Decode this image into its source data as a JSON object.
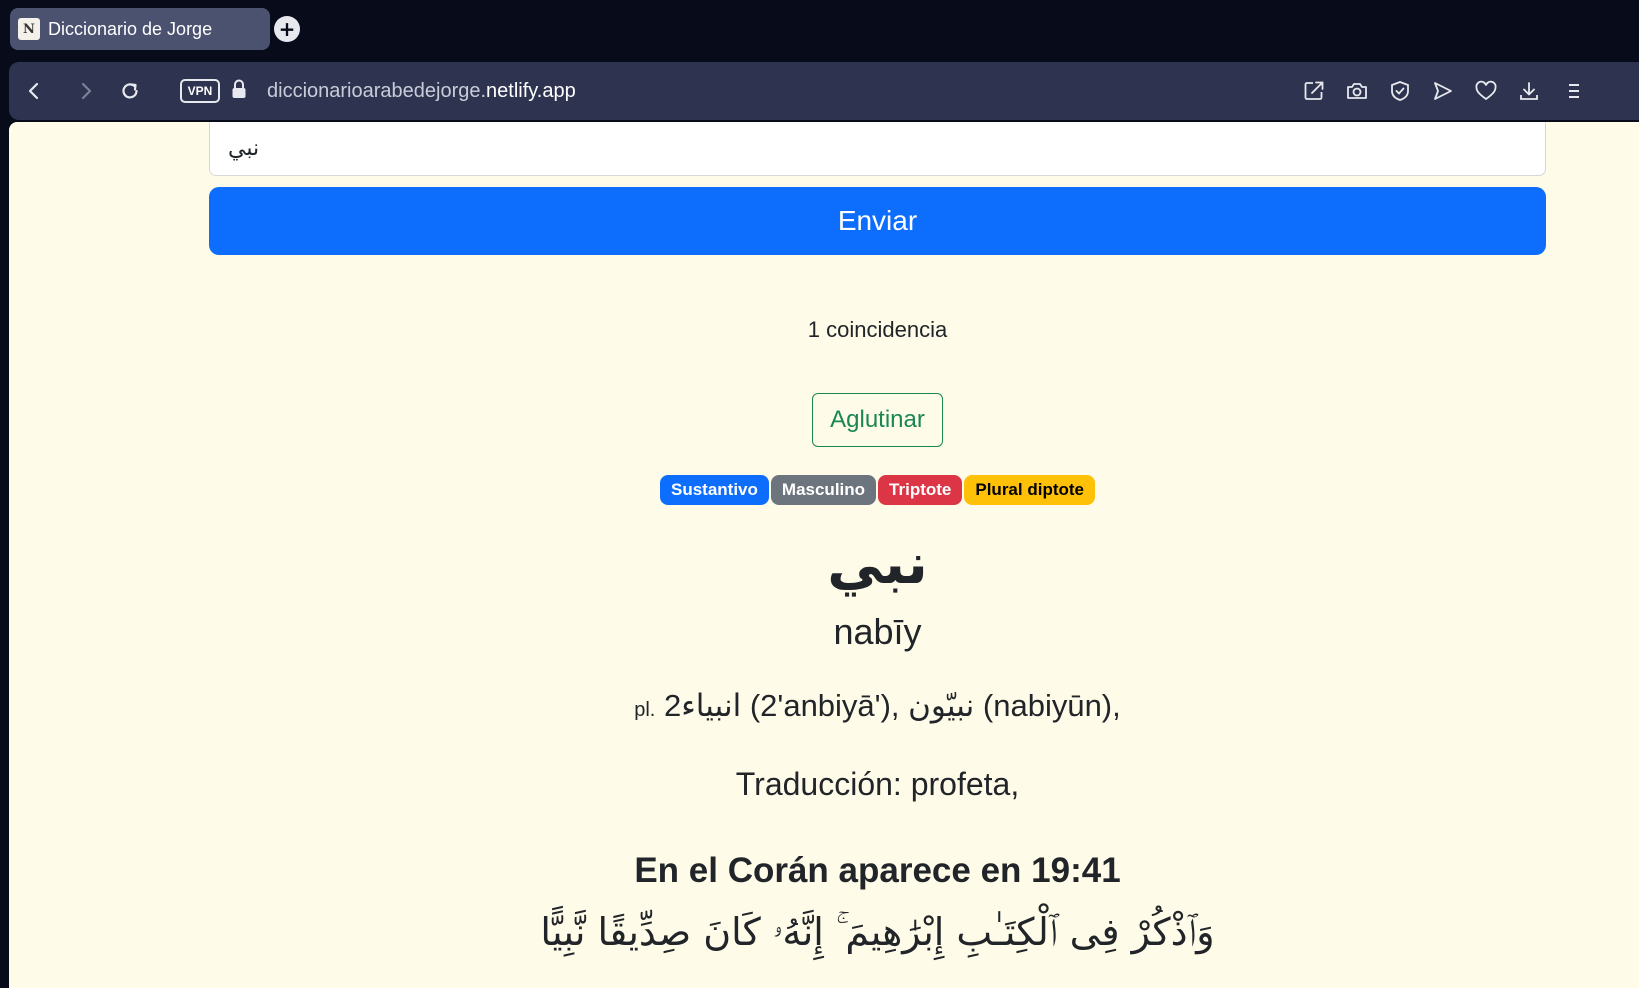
{
  "browser": {
    "tab_title": "Diccionario de Jorge",
    "favicon_letter": "N",
    "new_tab_symbol": "+",
    "vpn_label": "VPN",
    "url_prefix": "diccionarioarabedejorge.",
    "url_domain": "netlify.app"
  },
  "search": {
    "value": "نبي",
    "submit_label": "Enviar"
  },
  "results": {
    "match_count": "1 coincidencia",
    "agglutinate_label": "Aglutinar",
    "badges": [
      {
        "label": "Sustantivo",
        "bg": "#0d6efd",
        "fg": "#ffffff"
      },
      {
        "label": "Masculino",
        "bg": "#6c757d",
        "fg": "#ffffff"
      },
      {
        "label": "Triptote",
        "bg": "#dc3545",
        "fg": "#ffffff"
      },
      {
        "label": "Plural diptote",
        "bg": "#ffc107",
        "fg": "#000000"
      }
    ],
    "headword": "نبي",
    "transliteration": "nabīy",
    "plural_label": "pl.",
    "plurals": "2انبياء (2'anbiyā'),  نبيّون (nabiyūn),",
    "translation": "Traducción:  profeta,",
    "quran_heading": "En el Corán aparece en 19:41",
    "verse": "وَٱذْكُرْ فِى ٱلْكِتَـٰبِ إِبْرَٰهِيمَ ۚ إِنَّهُۥ كَانَ صِدِّيقًا نَّبِيًّا"
  },
  "colors": {
    "page_bg": "#fffbe9",
    "primary": "#0d6efd",
    "success": "#198754",
    "chrome_dark": "#070b1a",
    "chrome_bar": "#2e3450"
  },
  "icons": [
    "back-icon",
    "forward-icon",
    "reload-icon",
    "lock-icon",
    "share-icon",
    "camera-icon",
    "shield-icon",
    "send-icon",
    "heart-icon",
    "download-icon",
    "menu-icon"
  ]
}
